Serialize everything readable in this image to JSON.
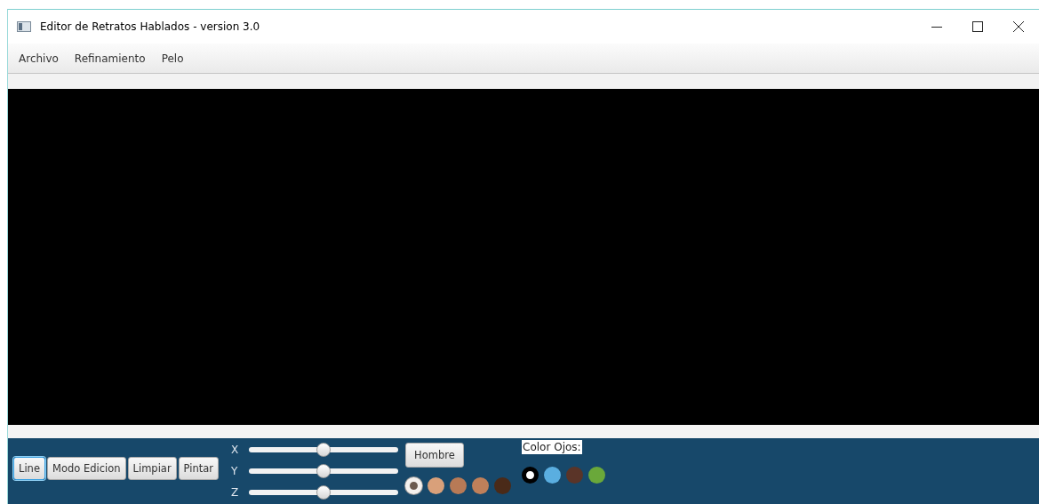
{
  "window": {
    "title": "Editor de Retratos Hablados - version 3.0"
  },
  "menu": [
    "Archivo",
    "Refinamiento",
    "Pelo"
  ],
  "toolbar": {
    "buttons": [
      {
        "label": "Line",
        "selected": true
      },
      {
        "label": "Modo Edicion",
        "selected": false
      },
      {
        "label": "Limpiar",
        "selected": false
      },
      {
        "label": "Pintar",
        "selected": false
      }
    ],
    "sliders": [
      {
        "label": "X",
        "level": 0.5
      },
      {
        "label": "Y",
        "level": 0.5
      },
      {
        "label": "Z",
        "level": 0.5
      }
    ],
    "gender_button": "Hombre",
    "skin_colors": [
      {
        "color": "#6b5a4e",
        "selected": true
      },
      {
        "color": "#d9a07a",
        "selected": false
      },
      {
        "color": "#b87a56",
        "selected": false
      },
      {
        "color": "#c0805a",
        "selected": false
      },
      {
        "color": "#4a2a18",
        "selected": false
      }
    ],
    "eye_color_label": "Color Ojos:",
    "eye_colors": [
      {
        "color": "#ffffff",
        "selected": true
      },
      {
        "color": "#5aaee0",
        "selected": false
      },
      {
        "color": "#5a3428",
        "selected": false
      },
      {
        "color": "#6aa83a",
        "selected": false
      }
    ]
  }
}
